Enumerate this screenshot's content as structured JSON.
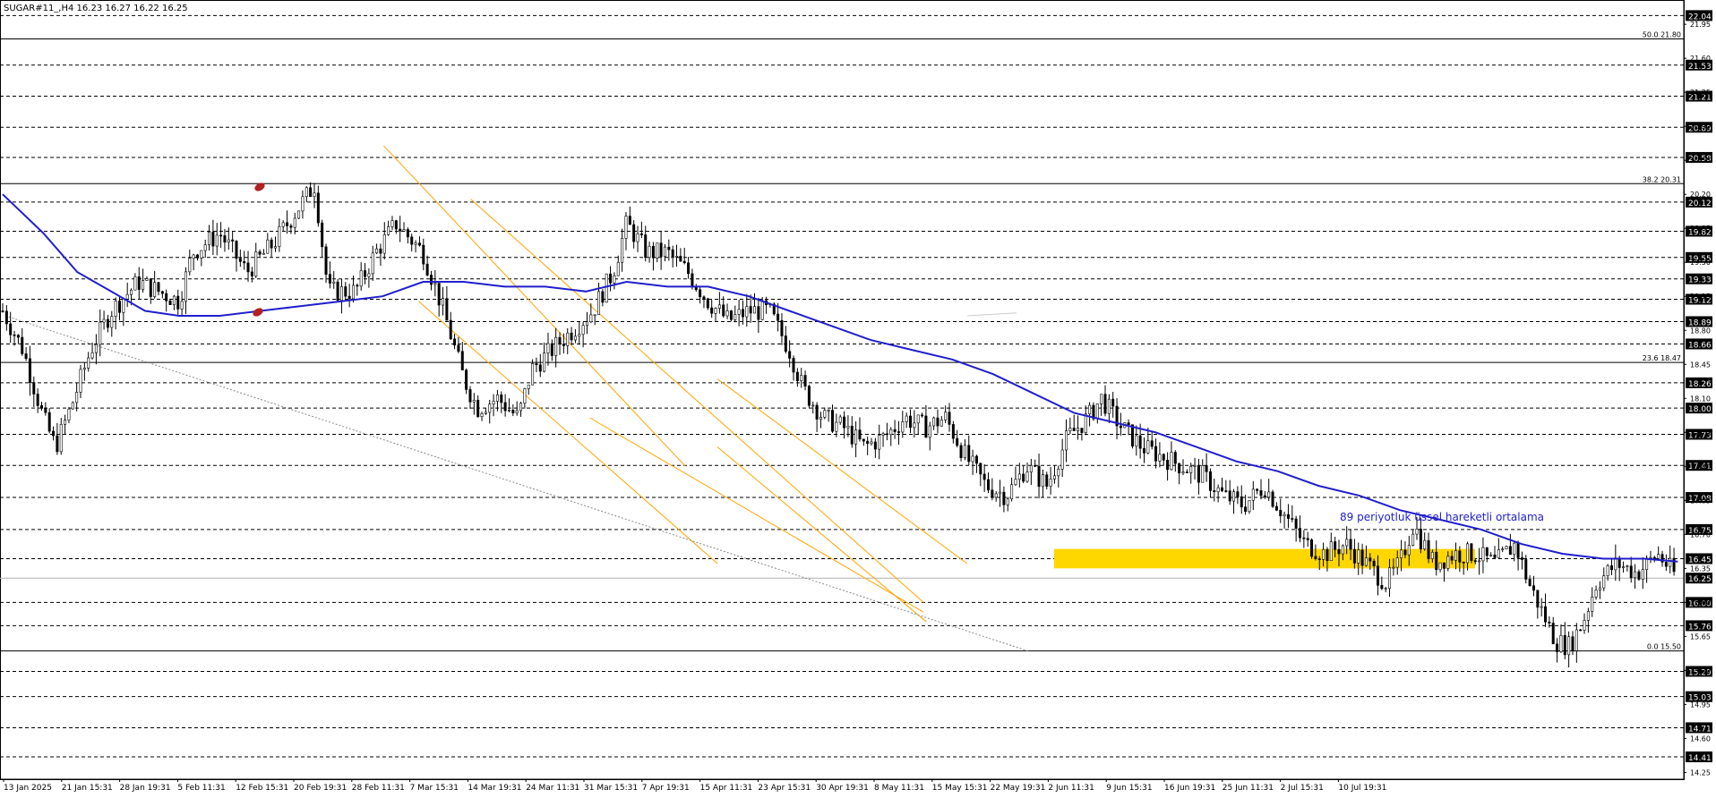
{
  "header": {
    "symbol_text": "SUGAR#11_,H4  16.23 16.27 16.22 16.25"
  },
  "chart_data": {
    "type": "candlestick",
    "symbol": "SUGAR#11_",
    "timeframe": "H4",
    "ohlc_last": {
      "open": 16.23,
      "high": 16.27,
      "low": 16.22,
      "close": 16.25
    },
    "ylim": [
      14.18,
      22.2
    ],
    "y_tick_labels": [
      "21.95",
      "21.60",
      "21.25",
      "20.90",
      "20.55",
      "20.20",
      "19.85",
      "19.50",
      "19.15",
      "18.80",
      "18.45",
      "18.10",
      "17.75",
      "17.40",
      "17.05",
      "16.70",
      "16.35",
      "16.00",
      "15.65",
      "15.30",
      "14.95",
      "14.60",
      "14.25"
    ],
    "x_tick_labels": [
      "13 Jan 2025",
      "21 Jan 15:31",
      "28 Jan 19:31",
      "5 Feb 11:31",
      "12 Feb 15:31",
      "20 Feb 19:31",
      "28 Feb 11:31",
      "7 Mar 15:31",
      "14 Mar 19:31",
      "24 Mar 11:31",
      "31 Mar 15:31",
      "7 Apr 19:31",
      "15 Apr 11:31",
      "23 Apr 15:31",
      "30 Apr 19:31",
      "8 May 11:31",
      "15 May 15:31",
      "22 May 19:31",
      "2 Jun 11:31",
      "9 Jun 15:31",
      "16 Jun 19:31",
      "25 Jun 11:31",
      "2 Jul 15:31",
      "10 Jul 19:31"
    ],
    "horizontal_levels": [
      22.04,
      21.53,
      21.21,
      20.89,
      20.58,
      20.12,
      19.82,
      19.55,
      19.33,
      19.12,
      18.89,
      18.66,
      18.26,
      18.0,
      17.73,
      17.41,
      17.08,
      16.75,
      16.45,
      16.0,
      15.76,
      15.29,
      15.03,
      14.71,
      14.41
    ],
    "current_price": 16.25,
    "fibonacci": [
      {
        "label": "50.0 21.80",
        "level": 21.8
      },
      {
        "label": "38.2 20.31",
        "level": 20.31
      },
      {
        "label": "23.6 18.47",
        "level": 18.47
      },
      {
        "label": "0.0 15.50",
        "level": 15.5
      }
    ],
    "support_zone": {
      "from": 16.35,
      "to": 16.55,
      "color": "#FFD700"
    },
    "ema_label": "89 periyotluk üssel hareketli ortalama",
    "ema_period": 89,
    "ema_color": "#1F1FCC",
    "channel_color": "#FFA500",
    "price_path": [
      [
        0,
        19.0
      ],
      [
        1.5,
        18.6
      ],
      [
        3,
        17.9
      ],
      [
        3.9,
        17.6
      ],
      [
        5,
        18.0
      ],
      [
        6.5,
        18.6
      ],
      [
        8,
        19.0
      ],
      [
        10,
        19.3
      ],
      [
        13,
        19.1
      ],
      [
        14,
        19.6
      ],
      [
        16,
        19.8
      ],
      [
        18,
        19.4
      ],
      [
        20,
        19.7
      ],
      [
        21.5,
        20.0
      ],
      [
        23,
        20.3
      ],
      [
        24,
        19.2
      ],
      [
        26,
        19.2
      ],
      [
        27.5,
        19.6
      ],
      [
        29,
        19.9
      ],
      [
        31,
        19.6
      ],
      [
        32.5,
        19.0
      ],
      [
        34,
        18.3
      ],
      [
        35,
        18.0
      ],
      [
        36.5,
        18.1
      ],
      [
        38,
        17.9
      ],
      [
        39,
        18.4
      ],
      [
        40.5,
        18.6
      ],
      [
        42,
        18.8
      ],
      [
        43.5,
        19.0
      ],
      [
        45,
        19.4
      ],
      [
        46,
        19.9
      ],
      [
        47.5,
        19.6
      ],
      [
        49,
        19.6
      ],
      [
        50.5,
        19.4
      ],
      [
        52,
        19.1
      ],
      [
        53.5,
        18.9
      ],
      [
        55,
        19.0
      ],
      [
        56.5,
        19.0
      ],
      [
        58,
        18.6
      ],
      [
        59,
        18.2
      ],
      [
        60.5,
        17.9
      ],
      [
        62,
        17.8
      ],
      [
        63.5,
        17.6
      ],
      [
        65,
        17.7
      ],
      [
        66.5,
        17.9
      ],
      [
        68,
        17.8
      ],
      [
        69.5,
        17.9
      ],
      [
        71,
        17.5
      ],
      [
        72.5,
        17.2
      ],
      [
        74,
        17.1
      ],
      [
        75.5,
        17.4
      ],
      [
        77,
        17.2
      ],
      [
        78.5,
        17.7
      ],
      [
        80,
        17.9
      ],
      [
        81,
        18.1
      ],
      [
        82.5,
        17.8
      ],
      [
        84,
        17.6
      ],
      [
        85.5,
        17.5
      ],
      [
        87,
        17.4
      ],
      [
        88.5,
        17.3
      ],
      [
        90,
        17.1
      ],
      [
        91.5,
        17.0
      ],
      [
        93,
        17.2
      ],
      [
        94.5,
        16.9
      ],
      [
        96,
        16.6
      ],
      [
        97.5,
        16.5
      ],
      [
        99,
        16.6
      ],
      [
        100.5,
        16.4
      ],
      [
        102,
        16.2
      ],
      [
        103,
        16.4
      ],
      [
        104,
        16.8
      ],
      [
        105.5,
        16.4
      ],
      [
        107,
        16.5
      ],
      [
        108.5,
        16.5
      ],
      [
        110,
        16.4
      ],
      [
        111.5,
        16.6
      ],
      [
        112.5,
        16.2
      ],
      [
        113.5,
        15.9
      ],
      [
        114.5,
        15.6
      ],
      [
        115.5,
        15.55
      ],
      [
        116.5,
        15.8
      ],
      [
        117.5,
        16.2
      ],
      [
        119,
        16.4
      ],
      [
        120.5,
        16.3
      ],
      [
        122,
        16.5
      ],
      [
        123.5,
        16.25
      ]
    ],
    "ema_path": [
      [
        0,
        20.2
      ],
      [
        3,
        19.8
      ],
      [
        5.5,
        19.4
      ],
      [
        8,
        19.2
      ],
      [
        10.5,
        19.0
      ],
      [
        13,
        18.95
      ],
      [
        16,
        18.95
      ],
      [
        19,
        19.0
      ],
      [
        22,
        19.05
      ],
      [
        25,
        19.1
      ],
      [
        28,
        19.15
      ],
      [
        31,
        19.3
      ],
      [
        34,
        19.3
      ],
      [
        37,
        19.25
      ],
      [
        40,
        19.25
      ],
      [
        43,
        19.2
      ],
      [
        46,
        19.3
      ],
      [
        49,
        19.25
      ],
      [
        52,
        19.25
      ],
      [
        55,
        19.15
      ],
      [
        58,
        19.0
      ],
      [
        61,
        18.85
      ],
      [
        64,
        18.7
      ],
      [
        67,
        18.6
      ],
      [
        70,
        18.5
      ],
      [
        73,
        18.35
      ],
      [
        76,
        18.15
      ],
      [
        79,
        17.95
      ],
      [
        82,
        17.85
      ],
      [
        85,
        17.75
      ],
      [
        88,
        17.6
      ],
      [
        91,
        17.45
      ],
      [
        94,
        17.35
      ],
      [
        97,
        17.2
      ],
      [
        100,
        17.1
      ],
      [
        103,
        16.95
      ],
      [
        106,
        16.85
      ],
      [
        109,
        16.75
      ],
      [
        112,
        16.6
      ],
      [
        115,
        16.5
      ],
      [
        118,
        16.45
      ],
      [
        121,
        16.45
      ],
      [
        123.5,
        16.42
      ]
    ]
  }
}
